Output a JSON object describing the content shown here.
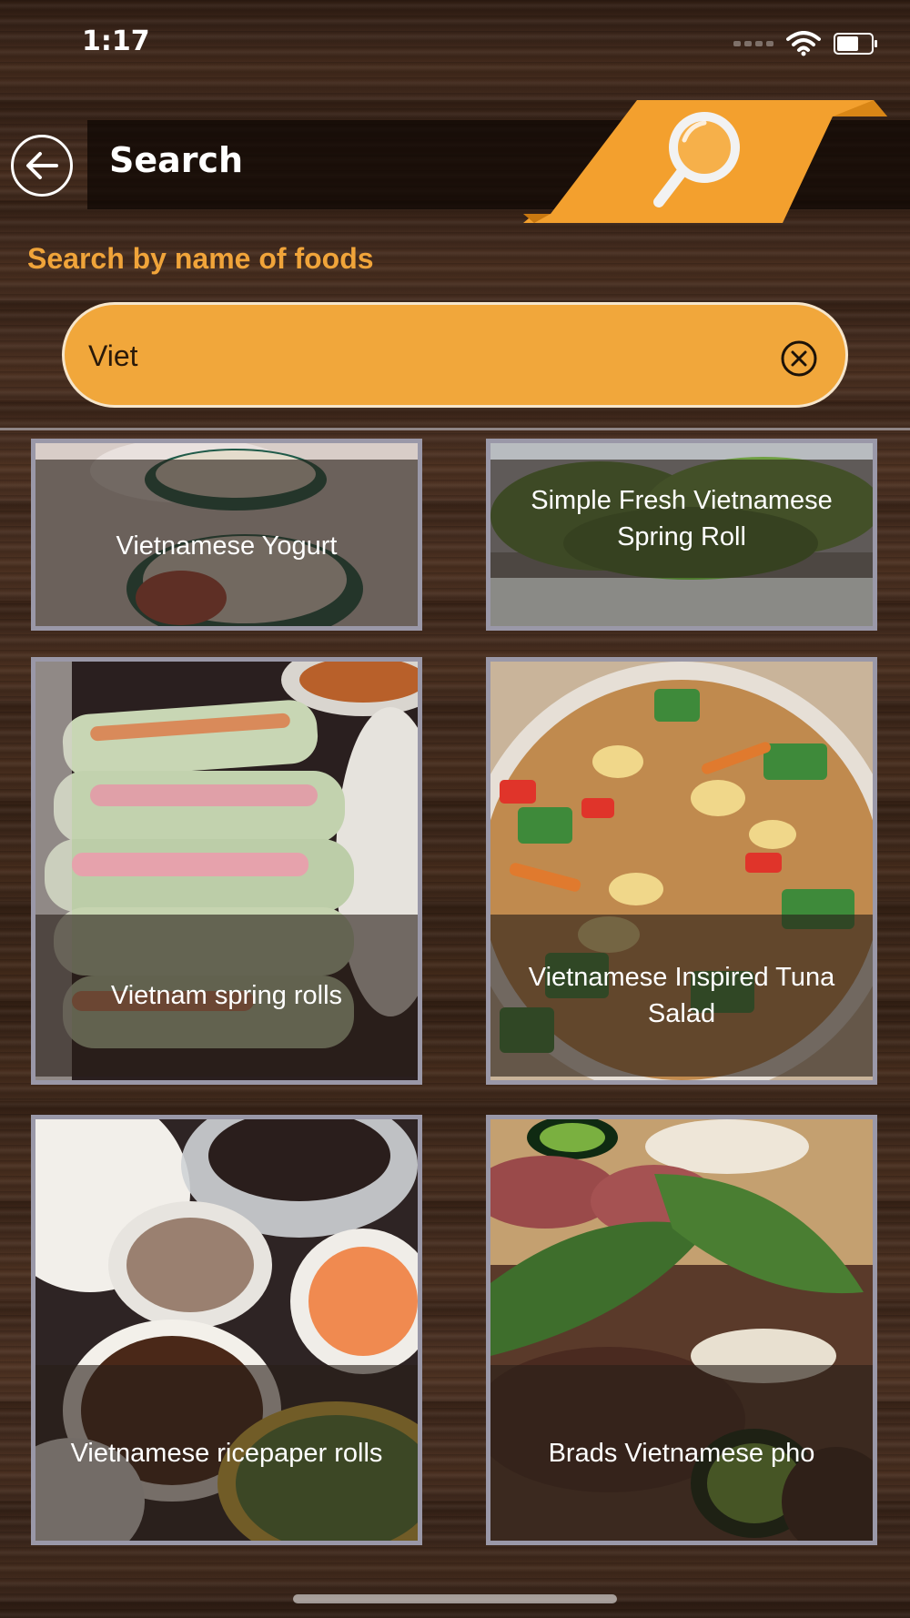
{
  "status_bar": {
    "time": "1:17",
    "battery_level": 0.65
  },
  "header": {
    "title": "Search",
    "back_icon": "arrow-left-circle-icon",
    "hero_icon": "magnifying-glass-icon"
  },
  "subtitle": "Search by name of foods",
  "search": {
    "value": "Viet",
    "clear_icon": "clear-circle-x-icon"
  },
  "colors": {
    "accent": "#f1a73b",
    "subtitle": "#f0a43a",
    "header_bg": "#140904",
    "card_border": "#9a98a8"
  },
  "results": [
    {
      "title": "Vietnamese Yogurt"
    },
    {
      "title": "Simple Fresh Vietnamese Spring Roll"
    },
    {
      "title": "Vietnam spring rolls"
    },
    {
      "title": "Vietnamese Inspired Tuna Salad"
    },
    {
      "title": "Vietnamese ricepaper rolls"
    },
    {
      "title": "Brads Vietnamese pho"
    }
  ]
}
